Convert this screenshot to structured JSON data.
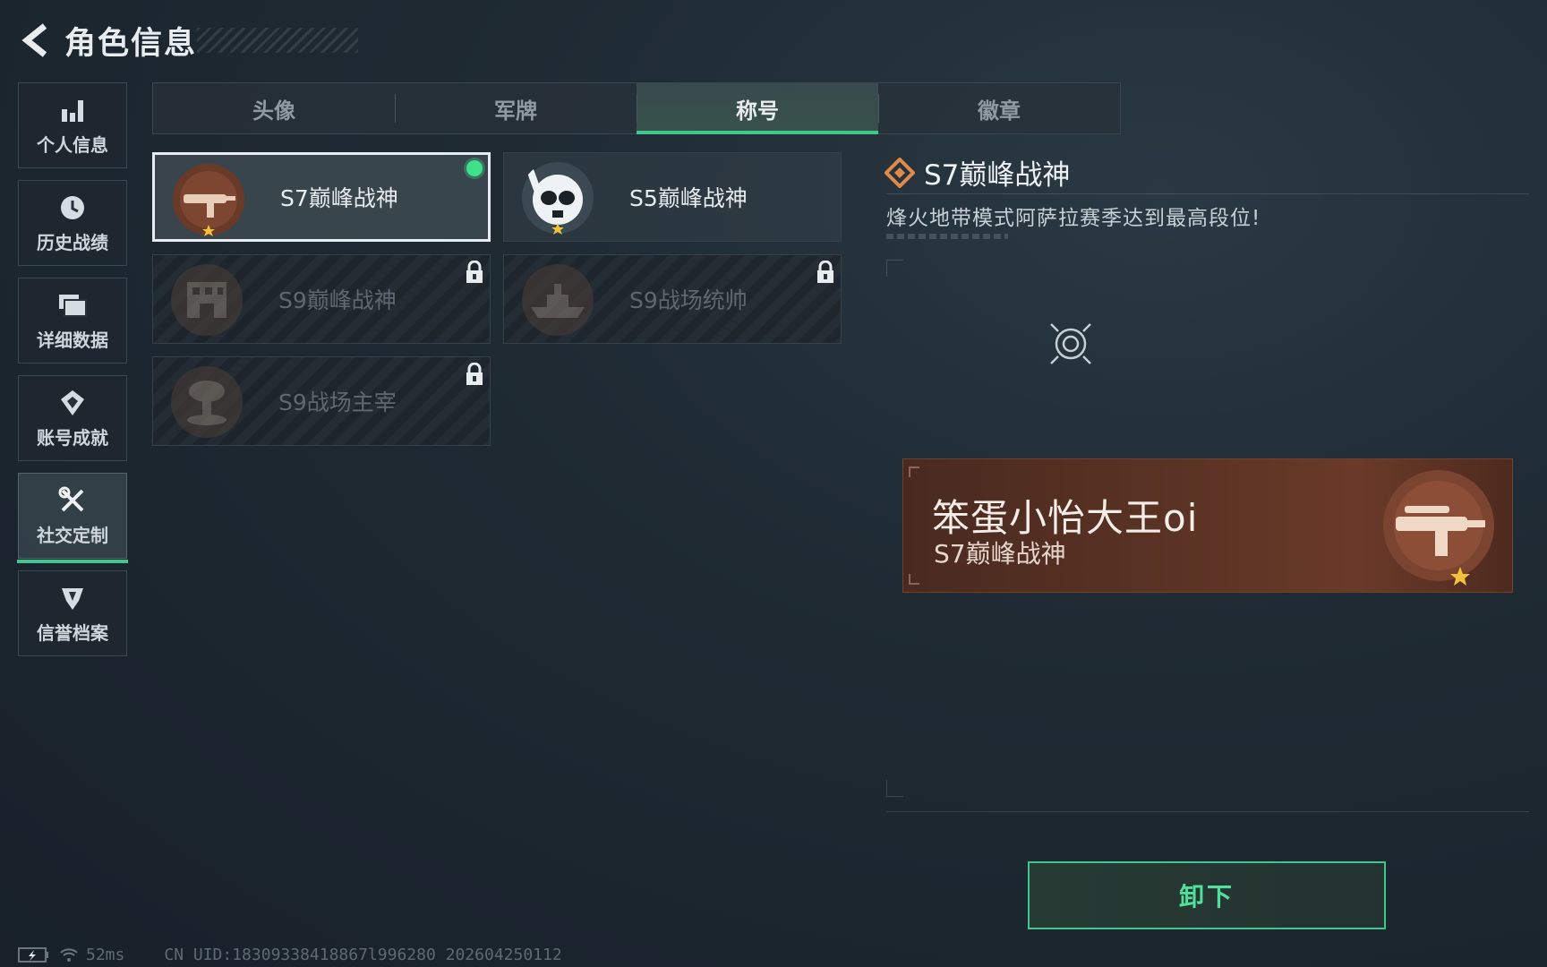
{
  "header": {
    "title": "角色信息"
  },
  "sidebar": {
    "items": [
      {
        "label": "个人信息",
        "icon": "bar-chart-icon"
      },
      {
        "label": "历史战绩",
        "icon": "history-clock-icon"
      },
      {
        "label": "详细数据",
        "icon": "folder-icon"
      },
      {
        "label": "账号成就",
        "icon": "achievement-icon"
      },
      {
        "label": "社交定制",
        "icon": "tools-icon",
        "active": true
      },
      {
        "label": "信誉档案",
        "icon": "credit-shield-icon"
      }
    ]
  },
  "tabs": [
    {
      "label": "头像"
    },
    {
      "label": "军牌"
    },
    {
      "label": "称号",
      "active": true
    },
    {
      "label": "徽章"
    }
  ],
  "titles": [
    {
      "name": "S7巅峰战神",
      "state": "equipped"
    },
    {
      "name": "S5巅峰战神",
      "state": "unlocked"
    },
    {
      "name": "S9巅峰战神",
      "state": "locked"
    },
    {
      "name": "S9战场统帅",
      "state": "locked"
    },
    {
      "name": "S9战场主宰",
      "state": "locked"
    }
  ],
  "detail": {
    "title": "S7巅峰战神",
    "description": "烽火地带模式阿萨拉赛季达到最高段位!"
  },
  "nameplate": {
    "player_name": "笨蛋小怡大王oi",
    "title": "S7巅峰战神"
  },
  "actions": {
    "unequip_label": "卸下"
  },
  "footer": {
    "ping": "52ms",
    "uid": "CN UID:18309338418867l996280 202604250112"
  },
  "colors": {
    "accent_green": "#3fc78e",
    "nameplate_bronze": "#5a3324",
    "background": "#1f2a33"
  }
}
